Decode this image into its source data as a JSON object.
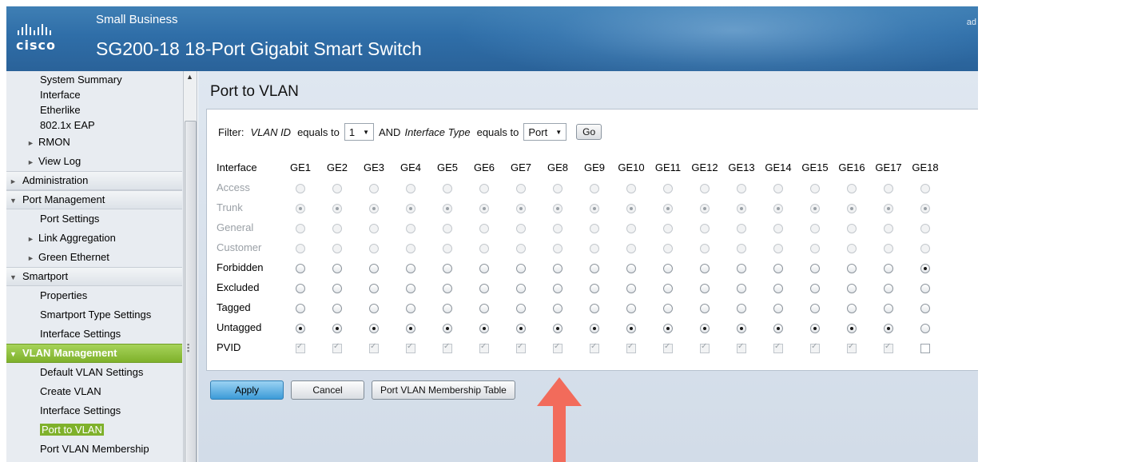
{
  "header": {
    "brand_small": "Small Business",
    "title": "SG200-18 18-Port Gigabit Smart Switch",
    "logo_text": "cisco",
    "user_fragment": "ad"
  },
  "sidebar": {
    "items": [
      {
        "label": "System Summary",
        "kind": "sub"
      },
      {
        "label": "Interface",
        "kind": "sub"
      },
      {
        "label": "Etherlike",
        "kind": "sub"
      },
      {
        "label": "802.1x EAP",
        "kind": "sub"
      },
      {
        "label": "RMON",
        "kind": "sub2"
      },
      {
        "label": "View Log",
        "kind": "sub2"
      },
      {
        "label": "Administration",
        "kind": "sec"
      },
      {
        "label": "Port Management",
        "kind": "sec"
      },
      {
        "label": "Port Settings",
        "kind": "sub"
      },
      {
        "label": "Link Aggregation",
        "kind": "sub2"
      },
      {
        "label": "Green Ethernet",
        "kind": "sub2"
      },
      {
        "label": "Smartport",
        "kind": "sec"
      },
      {
        "label": "Properties",
        "kind": "sub"
      },
      {
        "label": "Smartport Type Settings",
        "kind": "sub"
      },
      {
        "label": "Interface Settings",
        "kind": "sub"
      },
      {
        "label": "VLAN Management",
        "kind": "sec-active"
      },
      {
        "label": "Default VLAN Settings",
        "kind": "sub"
      },
      {
        "label": "Create VLAN",
        "kind": "sub"
      },
      {
        "label": "Interface Settings",
        "kind": "sub"
      },
      {
        "label": "Port to VLAN",
        "kind": "sub-selected"
      },
      {
        "label": "Port VLAN Membership",
        "kind": "sub"
      }
    ]
  },
  "main": {
    "page_title": "Port to VLAN",
    "filter": {
      "label": "Filter:",
      "field1": "VLAN ID",
      "equals1": "equals to",
      "vlan_value": "1",
      "and_text": "AND",
      "field2": "Interface Type",
      "equals2": "equals to",
      "type_value": "Port",
      "go_label": "Go"
    },
    "table": {
      "header_label": "Interface",
      "ports": [
        "GE1",
        "GE2",
        "GE3",
        "GE4",
        "GE5",
        "GE6",
        "GE7",
        "GE8",
        "GE9",
        "GE10",
        "GE11",
        "GE12",
        "GE13",
        "GE14",
        "GE15",
        "GE16",
        "GE17",
        "GE18"
      ],
      "rows": [
        {
          "label": "Access",
          "disabled": true,
          "type": "radio",
          "on": []
        },
        {
          "label": "Trunk",
          "disabled": true,
          "type": "radio",
          "on": [
            1,
            2,
            3,
            4,
            5,
            6,
            7,
            8,
            9,
            10,
            11,
            12,
            13,
            14,
            15,
            16,
            17,
            18
          ]
        },
        {
          "label": "General",
          "disabled": true,
          "type": "radio",
          "on": []
        },
        {
          "label": "Customer",
          "disabled": true,
          "type": "radio",
          "on": []
        },
        {
          "label": "Forbidden",
          "disabled": false,
          "type": "radio",
          "on": [
            18
          ]
        },
        {
          "label": "Excluded",
          "disabled": false,
          "type": "radio",
          "on": []
        },
        {
          "label": "Tagged",
          "disabled": false,
          "type": "radio",
          "on": []
        },
        {
          "label": "Untagged",
          "disabled": false,
          "type": "radio",
          "on": [
            1,
            2,
            3,
            4,
            5,
            6,
            7,
            8,
            9,
            10,
            11,
            12,
            13,
            14,
            15,
            16,
            17
          ]
        },
        {
          "label": "PVID",
          "disabled": false,
          "type": "checkbox",
          "on": [
            1,
            2,
            3,
            4,
            5,
            6,
            7,
            8,
            9,
            10,
            11,
            12,
            13,
            14,
            15,
            16,
            17
          ]
        }
      ]
    },
    "buttons": {
      "apply": "Apply",
      "cancel": "Cancel",
      "membership_table": "Port VLAN Membership Table"
    }
  },
  "colors": {
    "header_blue": "#2f6ea8",
    "nav_active_green": "#7fb12b",
    "apply_blue": "#3c9bd8",
    "annotation_red": "#f26b5b"
  }
}
